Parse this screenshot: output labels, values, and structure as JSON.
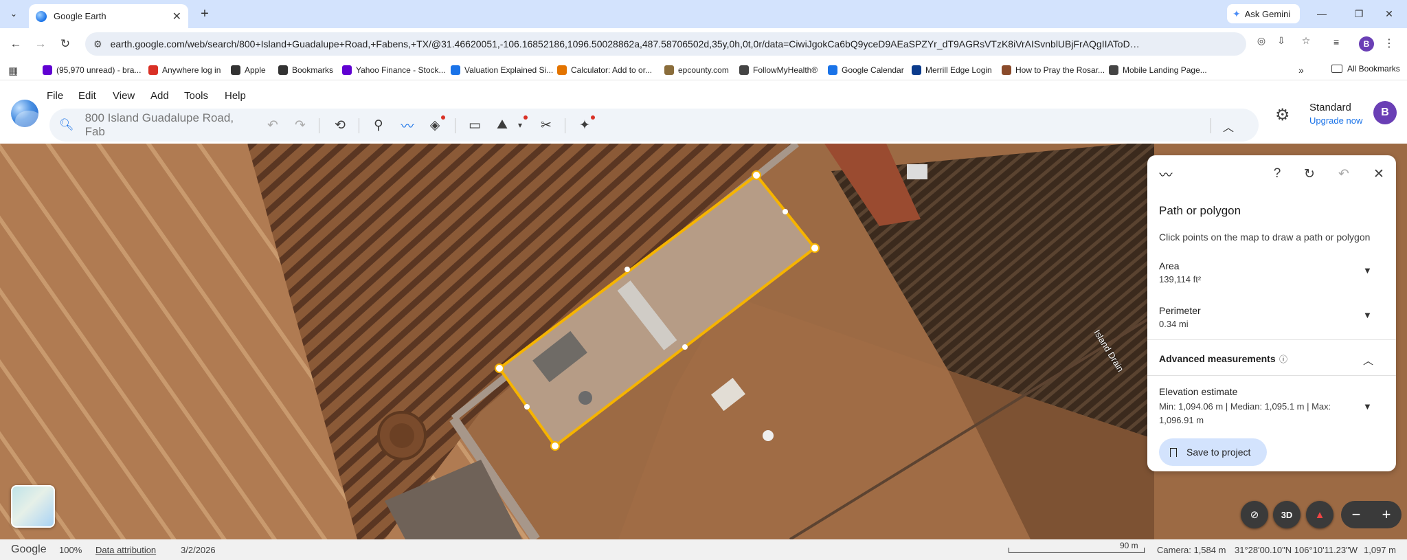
{
  "browser": {
    "tab_title": "Google Earth",
    "ask_gemini": "Ask Gemini",
    "url": "earth.google.com/web/search/800+Island+Guadalupe+Road,+Fabens,+TX/@31.46620051,-106.16852186,1096.50028862a,487.58706502d,35y,0h,0t,0r/data=CiwiJgokCa6bQ9yceD9AEaSPZYr_dT9AGRsVTzK8iVrAISvnblUBjFrAQgIIAToDCgEwQgIIAEoNCP__________...",
    "profile_initial": "B"
  },
  "bookmarks": [
    {
      "label": "(95,970 unread) - bra...",
      "icon": "yahoo-mail-icon",
      "color": "#6001d2"
    },
    {
      "label": "Anywhere log in",
      "icon": "anywhere-icon",
      "color": "#d93025"
    },
    {
      "label": "Apple",
      "icon": "apple-icon",
      "color": "#333333"
    },
    {
      "label": "Bookmarks",
      "icon": "star-icon",
      "color": "#333333"
    },
    {
      "label": "Yahoo Finance - Stock...",
      "icon": "yahoo-finance-icon",
      "color": "#6001d2"
    },
    {
      "label": "Valuation Explained Si...",
      "icon": "docs-icon",
      "color": "#1a73e8"
    },
    {
      "label": "Calculator: Add to or...",
      "icon": "calculator-icon",
      "color": "#e37400"
    },
    {
      "label": "epcounty.com",
      "icon": "county-seal-icon",
      "color": "#8a6d3b"
    },
    {
      "label": "FollowMyHealth®",
      "icon": "globe-icon",
      "color": "#444444"
    },
    {
      "label": "Google Calendar",
      "icon": "calendar-icon",
      "color": "#1a73e8"
    },
    {
      "label": "Merrill Edge Login",
      "icon": "merrill-icon",
      "color": "#0b3b8c"
    },
    {
      "label": "How to Pray the Rosar...",
      "icon": "rosary-icon",
      "color": "#8a4b2b"
    },
    {
      "label": "Mobile Landing Page...",
      "icon": "landing-icon",
      "color": "#444444"
    }
  ],
  "all_bookmarks": "All Bookmarks",
  "menu": [
    "File",
    "Edit",
    "View",
    "Add",
    "Tools",
    "Help"
  ],
  "search": {
    "placeholder": "800 Island Guadalupe Road, Fab"
  },
  "account": {
    "plan": "Standard",
    "upgrade": "Upgrade now",
    "initial": "B"
  },
  "map": {
    "place_label": "Island Drain"
  },
  "panel": {
    "title": "Path or polygon",
    "hint": "Click points on the map to draw a path or polygon",
    "area_label": "Area",
    "area_value": "139,114 ft²",
    "perimeter_label": "Perimeter",
    "perimeter_value": "0.34 mi",
    "advanced_label": "Advanced measurements",
    "elevation_label": "Elevation estimate",
    "elevation_values": "Min: 1,094.06 m | Median: 1,095.1 m | Max: 1,096.91 m",
    "save_label": "Save to project"
  },
  "controls": {
    "view_3d": "3D"
  },
  "status": {
    "brand": "Google",
    "zoom": "100%",
    "attribution": "Data attribution",
    "date": "3/2/2026",
    "scale": "90 m",
    "camera": "Camera: 1,584 m",
    "coords": "31°28'00.10\"N 106°10'11.23\"W",
    "elevation": "1,097 m"
  }
}
